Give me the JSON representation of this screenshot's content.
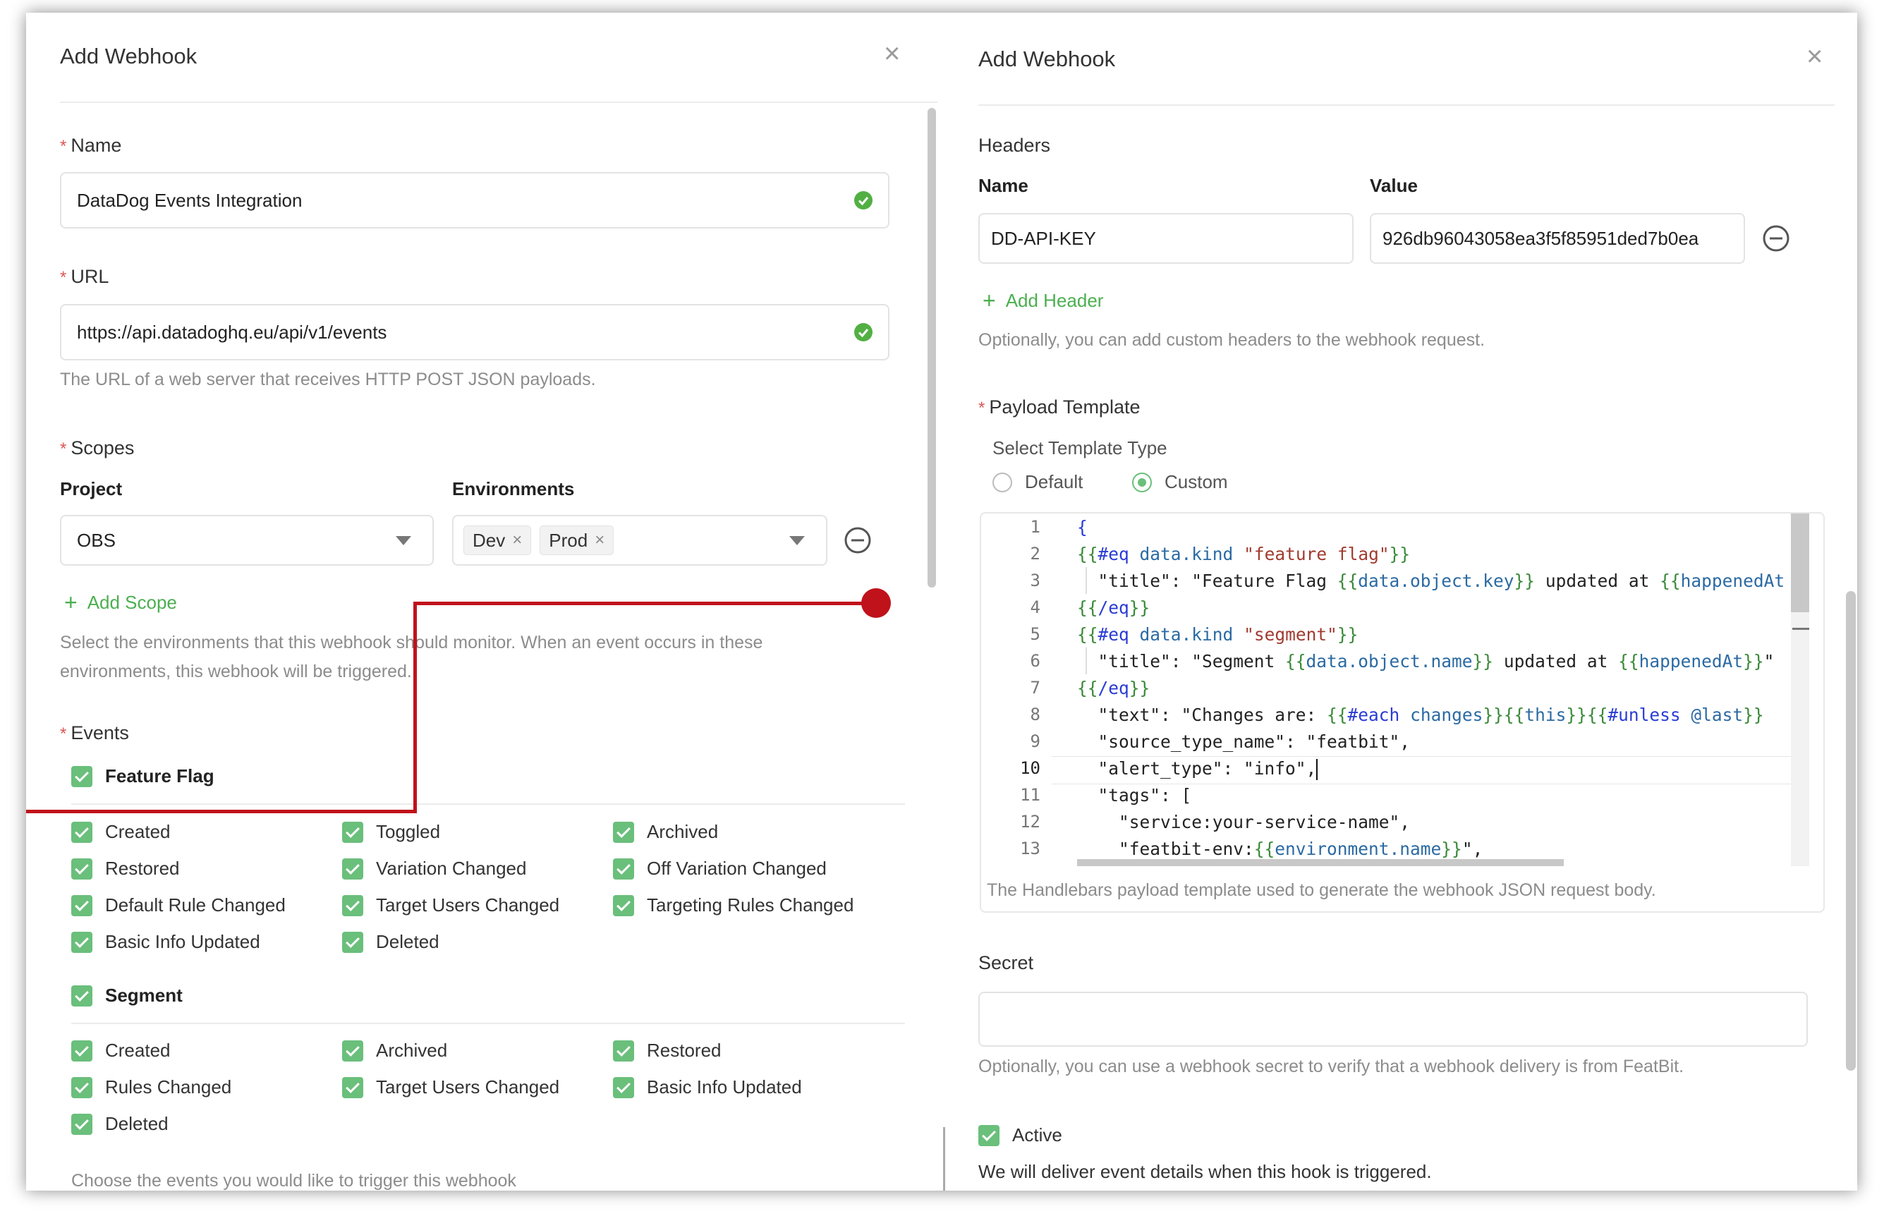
{
  "left": {
    "title": "Add Webhook",
    "close_icon": "close-icon",
    "name": {
      "label": "Name",
      "value": "DataDog Events Integration"
    },
    "url": {
      "label": "URL",
      "value": "https://api.datadoghq.eu/api/v1/events",
      "help": "The URL of a web server that receives HTTP POST JSON payloads."
    },
    "scopes": {
      "label": "Scopes",
      "project_label": "Project",
      "project_value": "OBS",
      "environments_label": "Environments",
      "environments": [
        "Dev",
        "Prod"
      ],
      "add_scope": "Add Scope",
      "help": "Select the environments that this webhook should monitor. When an event occurs in these environments, this webhook will be triggered."
    },
    "events": {
      "label": "Events",
      "feature_flag": {
        "label": "Feature Flag",
        "items": [
          "Created",
          "Toggled",
          "Archived",
          "Restored",
          "Variation Changed",
          "Off Variation Changed",
          "Default Rule Changed",
          "Target Users Changed",
          "Targeting Rules Changed",
          "Basic Info Updated",
          "Deleted"
        ]
      },
      "segment": {
        "label": "Segment",
        "items": [
          "Created",
          "Archived",
          "Restored",
          "Rules Changed",
          "Target Users Changed",
          "Basic Info Updated",
          "Deleted"
        ]
      },
      "help": "Choose the events you would like to trigger this webhook"
    }
  },
  "right": {
    "title": "Add Webhook",
    "headers": {
      "label": "Headers",
      "name_col": "Name",
      "value_col": "Value",
      "name_value": "DD-API-KEY",
      "value_value": "926db96043058ea3f5f85951ded7b0ea",
      "add_header": "Add Header",
      "help": "Optionally, you can add custom headers to the webhook request."
    },
    "payload": {
      "label": "Payload Template",
      "select_type": "Select Template Type",
      "default_option": "Default",
      "custom_option": "Custom",
      "selected": "Custom",
      "line_numbers": [
        "1",
        "2",
        "3",
        "4",
        "5",
        "6",
        "7",
        "8",
        "9",
        "10",
        "11",
        "12",
        "13"
      ],
      "help": "The Handlebars payload template used to generate the webhook JSON request body."
    },
    "secret": {
      "label": "Secret",
      "value": "",
      "help": "Optionally, you can use a webhook secret to verify that a webhook delivery is from FeatBit."
    },
    "active": {
      "label": "Active",
      "help": "We will deliver event details when this hook is triggered."
    }
  },
  "colors": {
    "accent": "#6abf7b",
    "annotation": "#c0121b",
    "required": "#e05555"
  }
}
